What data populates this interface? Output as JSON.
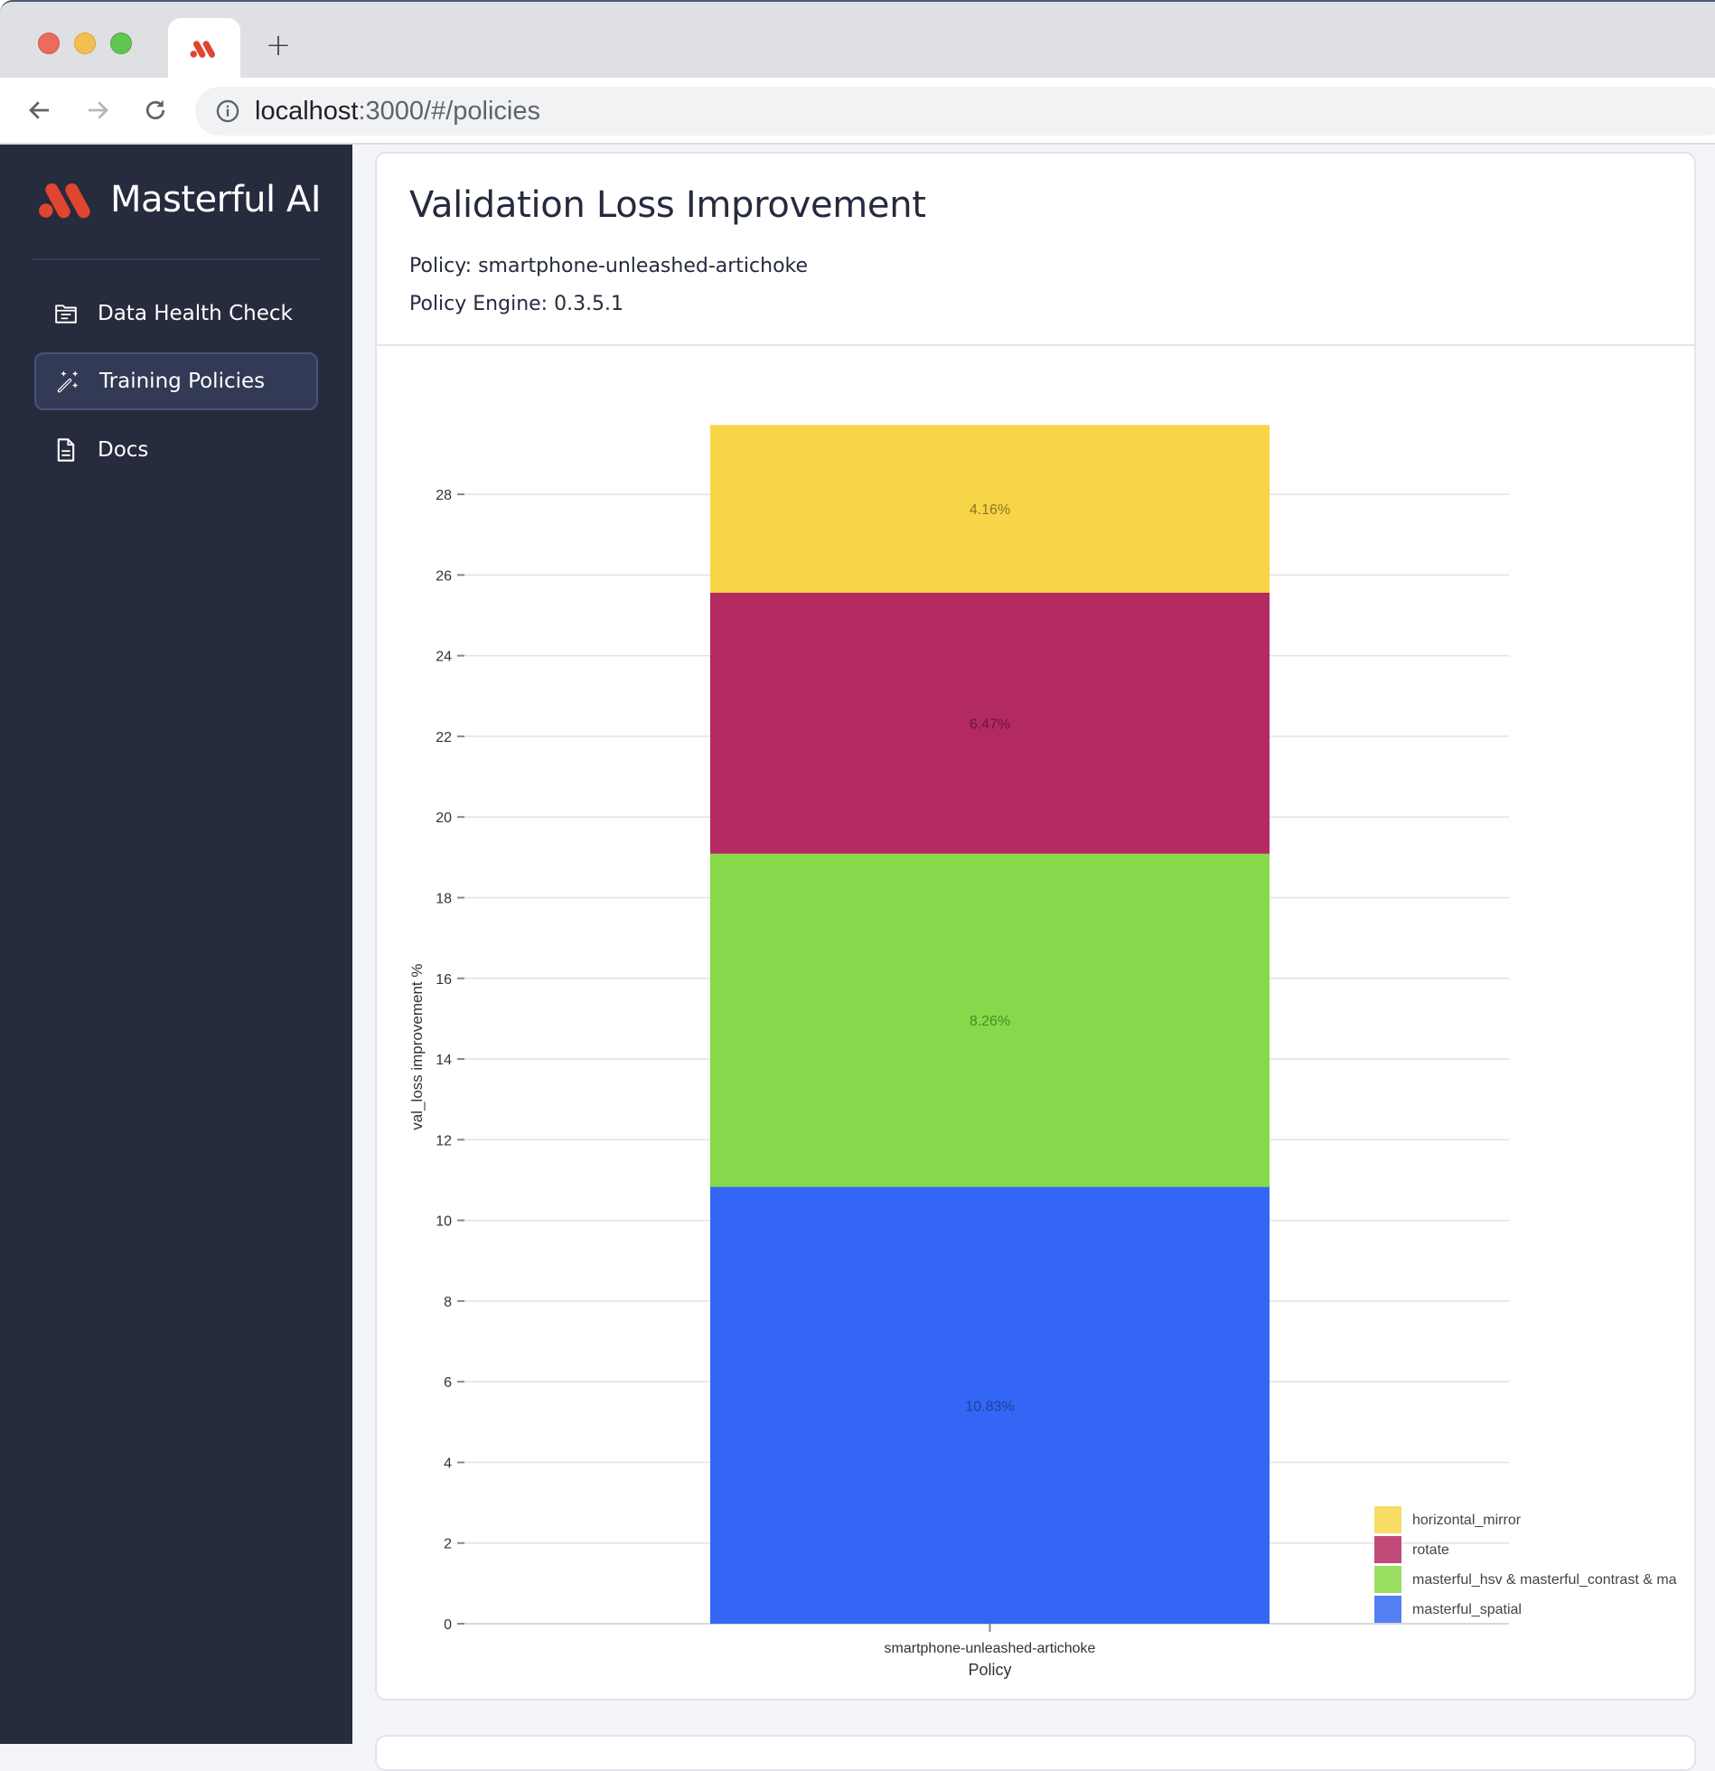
{
  "browser": {
    "tab_icon": "masterful-logo-icon",
    "new_tab_label": "+",
    "url_host": "localhost",
    "url_rest": ":3000/#/policies"
  },
  "sidebar": {
    "brand_name": "Masterful AI",
    "items": [
      {
        "label": "Data Health Check",
        "icon": "folder-icon",
        "active": false
      },
      {
        "label": "Training Policies",
        "icon": "magic-wand-icon",
        "active": true
      },
      {
        "label": "Docs",
        "icon": "document-icon",
        "active": false
      }
    ]
  },
  "card": {
    "title": "Validation Loss Improvement",
    "policy_line": "Policy: smartphone-unleashed-artichoke",
    "engine_line": "Policy Engine: 0.3.5.1"
  },
  "colors": {
    "sidebar_bg": "#262b3d",
    "brand_red": "#e04530",
    "horizontal_mirror": "#f8d448",
    "rotate": "#b32a60",
    "masterful_hsv": "#86d94a",
    "masterful_spatial": "#3366f5"
  },
  "chart_data": {
    "type": "bar",
    "stacked": true,
    "categories": [
      "smartphone-unleashed-artichoke"
    ],
    "series": [
      {
        "name": "masterful_spatial",
        "values": [
          10.83
        ],
        "label": "10.83%",
        "color": "#3366f5",
        "legend_color": "#5580f5",
        "label_color": "#1f3f99"
      },
      {
        "name": "masterful_hsv & masterful_contrast & ma",
        "values": [
          8.26
        ],
        "label": "8.26%",
        "color": "#86d94a",
        "legend_color": "#9ade62",
        "label_color": "#4c8a26"
      },
      {
        "name": "rotate",
        "values": [
          6.47
        ],
        "label": "6.47%",
        "color": "#b32a60",
        "legend_color": "#c14a78",
        "label_color": "#6e1638"
      },
      {
        "name": "horizontal_mirror",
        "values": [
          4.16
        ],
        "label": "4.16%",
        "color": "#f8d448",
        "legend_color": "#f8dc66",
        "label_color": "#8a7622"
      }
    ],
    "legend_order": [
      "horizontal_mirror",
      "rotate",
      "masterful_hsv & masterful_contrast & ma",
      "masterful_spatial"
    ],
    "title": "",
    "xlabel": "Policy",
    "ylabel": "val_loss improvement %",
    "yticks": [
      0,
      2,
      4,
      6,
      8,
      10,
      12,
      14,
      16,
      18,
      20,
      22,
      24,
      26,
      28
    ],
    "ylim": [
      0,
      30
    ],
    "grid": true,
    "legend_position": "bottom-right"
  }
}
